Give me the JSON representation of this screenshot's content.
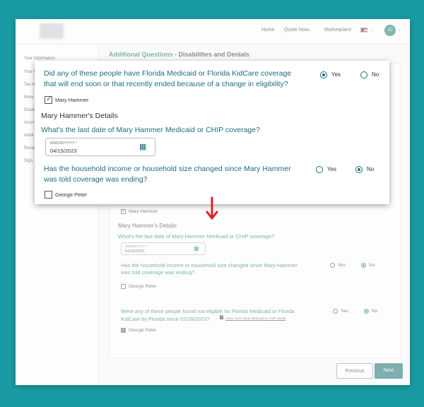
{
  "header": {
    "nav": [
      "Home",
      "Quote Now",
      "Marketplace"
    ],
    "user_initials": "JC"
  },
  "sidebar": {
    "items": [
      "Your Information",
      "Your H",
      "Tax H",
      "More",
      "Disab",
      "Incom",
      "Addit",
      "Review",
      "Sign"
    ]
  },
  "page": {
    "title_accent": "Additional Questions",
    "title_rest": " - Disabilities and Denials"
  },
  "background_form": {
    "member_1": "Mary Hammer",
    "details_heading": "Mary Hammer's Details",
    "date_question": "What's the last date of Mary Hammer Medicaid or CHIP coverage?",
    "date_label": "MM/DD/YYYY *",
    "date_value": "04/15/2023",
    "income_question_line1": "Has the household income or household size changed since Mary Hammer",
    "income_question_line2": "was told coverage was ending?",
    "yes": "Yes",
    "no": "No",
    "member_2": "George Peter",
    "denied_question_line1": "Were any of these people found not eligible for Florida Medicaid or Florida",
    "denied_question_line2": "KidCare by Florida since 02/28/2023?",
    "learn_more": "Learn more about Medicaid or CHIP denial",
    "member_3": "George Peter"
  },
  "buttons": {
    "previous": "Previous",
    "next": "Next"
  },
  "zoom_panel": {
    "question_1": "Did any of these people have Florida Medicaid or Florida KidCare coverage that will end soon or that recently ended because of a change in eligibility?",
    "yes": "Yes",
    "no": "No",
    "member_1": "Mary Hammer",
    "details_heading": "Mary Hammer's Details",
    "date_question": "What's the last date of Mary Hammer Medicaid or CHIP coverage?",
    "date_label": "MM/DD/YYYY *",
    "date_value": "04/15/2023",
    "income_question": "Has the household income or household size changed since Mary Hammer was told coverage was ending?",
    "member_2": "George Peter"
  },
  "colors": {
    "page_bg": "#1a9ba3",
    "accent": "#1a6f79",
    "next_button": "#1a6f6f",
    "arrow": "#e02020"
  }
}
